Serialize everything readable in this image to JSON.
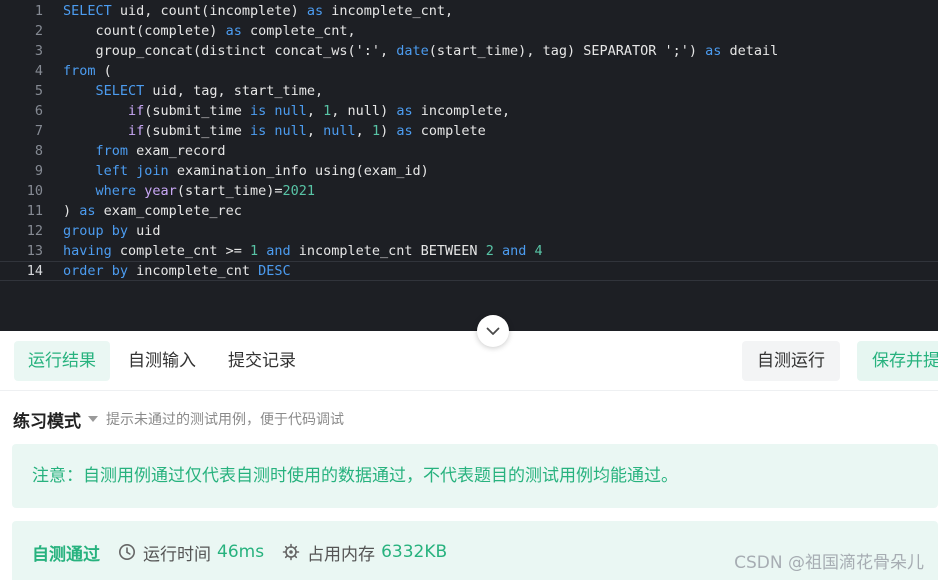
{
  "editor": {
    "lines": [
      {
        "n": "1",
        "tokens": [
          [
            "kw",
            "SELECT"
          ],
          [
            "id",
            " uid, count(incomplete) "
          ],
          [
            "kw",
            "as"
          ],
          [
            "id",
            " incomplete_cnt,"
          ]
        ]
      },
      {
        "n": "2",
        "tokens": [
          [
            "id",
            "    count(complete) "
          ],
          [
            "kw",
            "as"
          ],
          [
            "id",
            " complete_cnt,"
          ]
        ]
      },
      {
        "n": "3",
        "tokens": [
          [
            "id",
            "    group_concat(distinct concat_ws("
          ],
          [
            "str",
            "':'"
          ],
          [
            "id",
            ", "
          ],
          [
            "kw",
            "date"
          ],
          [
            "id",
            "(start_time), tag) SEPARATOR "
          ],
          [
            "str",
            "';'"
          ],
          [
            "id",
            ") "
          ],
          [
            "kw",
            "as"
          ],
          [
            "id",
            " detail"
          ]
        ]
      },
      {
        "n": "4",
        "tokens": [
          [
            "kw",
            "from"
          ],
          [
            "id",
            " ("
          ]
        ]
      },
      {
        "n": "5",
        "tokens": [
          [
            "id",
            "    "
          ],
          [
            "kw",
            "SELECT"
          ],
          [
            "id",
            " uid, tag, start_time,"
          ]
        ]
      },
      {
        "n": "6",
        "tokens": [
          [
            "id",
            "        "
          ],
          [
            "fn",
            "if"
          ],
          [
            "id",
            "(submit_time "
          ],
          [
            "kw",
            "is"
          ],
          [
            "id",
            " "
          ],
          [
            "kw",
            "null"
          ],
          [
            "id",
            ", "
          ],
          [
            "num",
            "1"
          ],
          [
            "id",
            ", null) "
          ],
          [
            "kw",
            "as"
          ],
          [
            "id",
            " incomplete,"
          ]
        ]
      },
      {
        "n": "7",
        "tokens": [
          [
            "id",
            "        "
          ],
          [
            "fn",
            "if"
          ],
          [
            "id",
            "(submit_time "
          ],
          [
            "kw",
            "is"
          ],
          [
            "id",
            " "
          ],
          [
            "kw",
            "null"
          ],
          [
            "id",
            ", "
          ],
          [
            "kw",
            "null"
          ],
          [
            "id",
            ", "
          ],
          [
            "num",
            "1"
          ],
          [
            "id",
            ") "
          ],
          [
            "kw",
            "as"
          ],
          [
            "id",
            " complete"
          ]
        ]
      },
      {
        "n": "8",
        "tokens": [
          [
            "id",
            "    "
          ],
          [
            "kw",
            "from"
          ],
          [
            "id",
            " exam_record"
          ]
        ]
      },
      {
        "n": "9",
        "tokens": [
          [
            "id",
            "    "
          ],
          [
            "kw",
            "left"
          ],
          [
            "id",
            " "
          ],
          [
            "kw",
            "join"
          ],
          [
            "id",
            " examination_info using(exam_id)"
          ]
        ]
      },
      {
        "n": "10",
        "tokens": [
          [
            "id",
            "    "
          ],
          [
            "kw",
            "where"
          ],
          [
            "id",
            " "
          ],
          [
            "fn",
            "year"
          ],
          [
            "id",
            "(start_time)="
          ],
          [
            "num",
            "2021"
          ]
        ]
      },
      {
        "n": "11",
        "tokens": [
          [
            "id",
            ") "
          ],
          [
            "kw",
            "as"
          ],
          [
            "id",
            " exam_complete_rec"
          ]
        ]
      },
      {
        "n": "12",
        "tokens": [
          [
            "kw",
            "group"
          ],
          [
            "id",
            " "
          ],
          [
            "kw",
            "by"
          ],
          [
            "id",
            " uid"
          ]
        ]
      },
      {
        "n": "13",
        "tokens": [
          [
            "kw",
            "having"
          ],
          [
            "id",
            " complete_cnt >= "
          ],
          [
            "num",
            "1"
          ],
          [
            "id",
            " "
          ],
          [
            "kw",
            "and"
          ],
          [
            "id",
            " incomplete_cnt BETWEEN "
          ],
          [
            "num",
            "2"
          ],
          [
            "id",
            " "
          ],
          [
            "kw",
            "and"
          ],
          [
            "id",
            " "
          ],
          [
            "num",
            "4"
          ]
        ]
      },
      {
        "n": "14",
        "tokens": [
          [
            "kw",
            "order"
          ],
          [
            "id",
            " "
          ],
          [
            "kw",
            "by"
          ],
          [
            "id",
            " incomplete_cnt "
          ],
          [
            "kw",
            "DESC"
          ]
        ]
      }
    ]
  },
  "tabs": {
    "run_result": "运行结果",
    "self_input": "自测输入",
    "submit_record": "提交记录"
  },
  "actions": {
    "self_run": "自测运行",
    "save_submit": "保存并提交"
  },
  "mode": {
    "label": "练习模式",
    "hint": "提示未通过的测试用例，便于代码调试"
  },
  "notice": "注意：自测用例通过仅代表自测时使用的数据通过，不代表题目的测试用例均能通过。",
  "result": {
    "status": "自测通过",
    "time_label": "运行时间",
    "time_value": "46ms",
    "memory_label": "占用内存",
    "memory_value": "6332KB"
  },
  "watermark": "CSDN @祖国滴花骨朵儿",
  "colors": {
    "editor_bg": "#1d1f24",
    "keyword": "#4c9cf0",
    "function": "#c9a8f6",
    "number": "#58c4a6",
    "accent_green": "#27b27e"
  }
}
